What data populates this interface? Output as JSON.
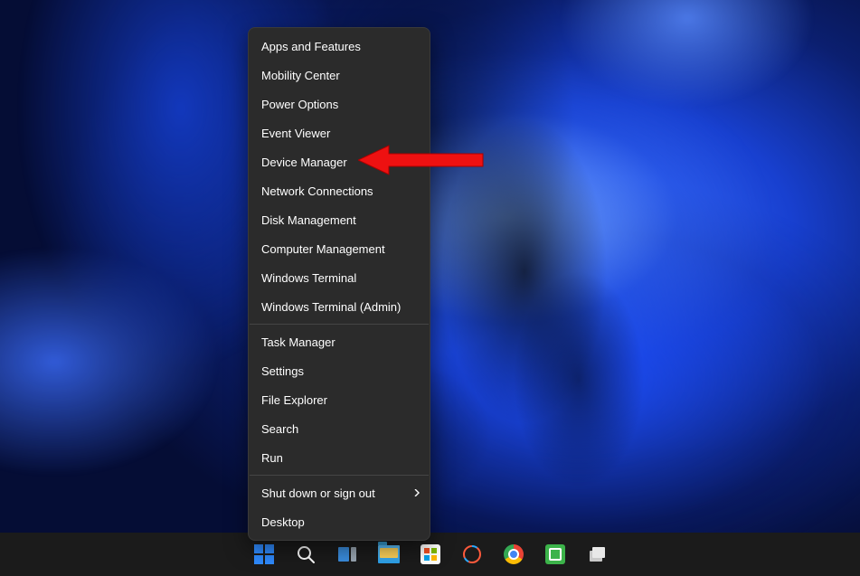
{
  "menu": {
    "groups": [
      [
        {
          "label": "Apps and Features",
          "name": "menu-item-apps-and-features"
        },
        {
          "label": "Mobility Center",
          "name": "menu-item-mobility-center"
        },
        {
          "label": "Power Options",
          "name": "menu-item-power-options"
        },
        {
          "label": "Event Viewer",
          "name": "menu-item-event-viewer"
        },
        {
          "label": "Device Manager",
          "name": "menu-item-device-manager"
        },
        {
          "label": "Network Connections",
          "name": "menu-item-network-connections"
        },
        {
          "label": "Disk Management",
          "name": "menu-item-disk-management"
        },
        {
          "label": "Computer Management",
          "name": "menu-item-computer-management"
        },
        {
          "label": "Windows Terminal",
          "name": "menu-item-windows-terminal"
        },
        {
          "label": "Windows Terminal (Admin)",
          "name": "menu-item-windows-terminal-admin"
        }
      ],
      [
        {
          "label": "Task Manager",
          "name": "menu-item-task-manager"
        },
        {
          "label": "Settings",
          "name": "menu-item-settings"
        },
        {
          "label": "File Explorer",
          "name": "menu-item-file-explorer"
        },
        {
          "label": "Search",
          "name": "menu-item-search"
        },
        {
          "label": "Run",
          "name": "menu-item-run"
        }
      ],
      [
        {
          "label": "Shut down or sign out",
          "name": "menu-item-shut-down-or-sign-out",
          "submenu": true
        },
        {
          "label": "Desktop",
          "name": "menu-item-desktop"
        }
      ]
    ]
  },
  "annotation": {
    "target": "Device Manager",
    "color": "#e11"
  },
  "taskbar": {
    "items": [
      {
        "name": "start-button",
        "icon": "windows-logo-icon"
      },
      {
        "name": "search-button",
        "icon": "search-icon"
      },
      {
        "name": "task-view-button",
        "icon": "task-view-icon"
      },
      {
        "name": "file-explorer-button",
        "icon": "folder-icon"
      },
      {
        "name": "microsoft-store-button",
        "icon": "store-icon"
      },
      {
        "name": "app-button-1",
        "icon": "circle-app-icon"
      },
      {
        "name": "chrome-button",
        "icon": "chrome-icon"
      },
      {
        "name": "app-button-2",
        "icon": "green-app-icon"
      },
      {
        "name": "app-button-3",
        "icon": "grey-app-icon"
      }
    ]
  }
}
